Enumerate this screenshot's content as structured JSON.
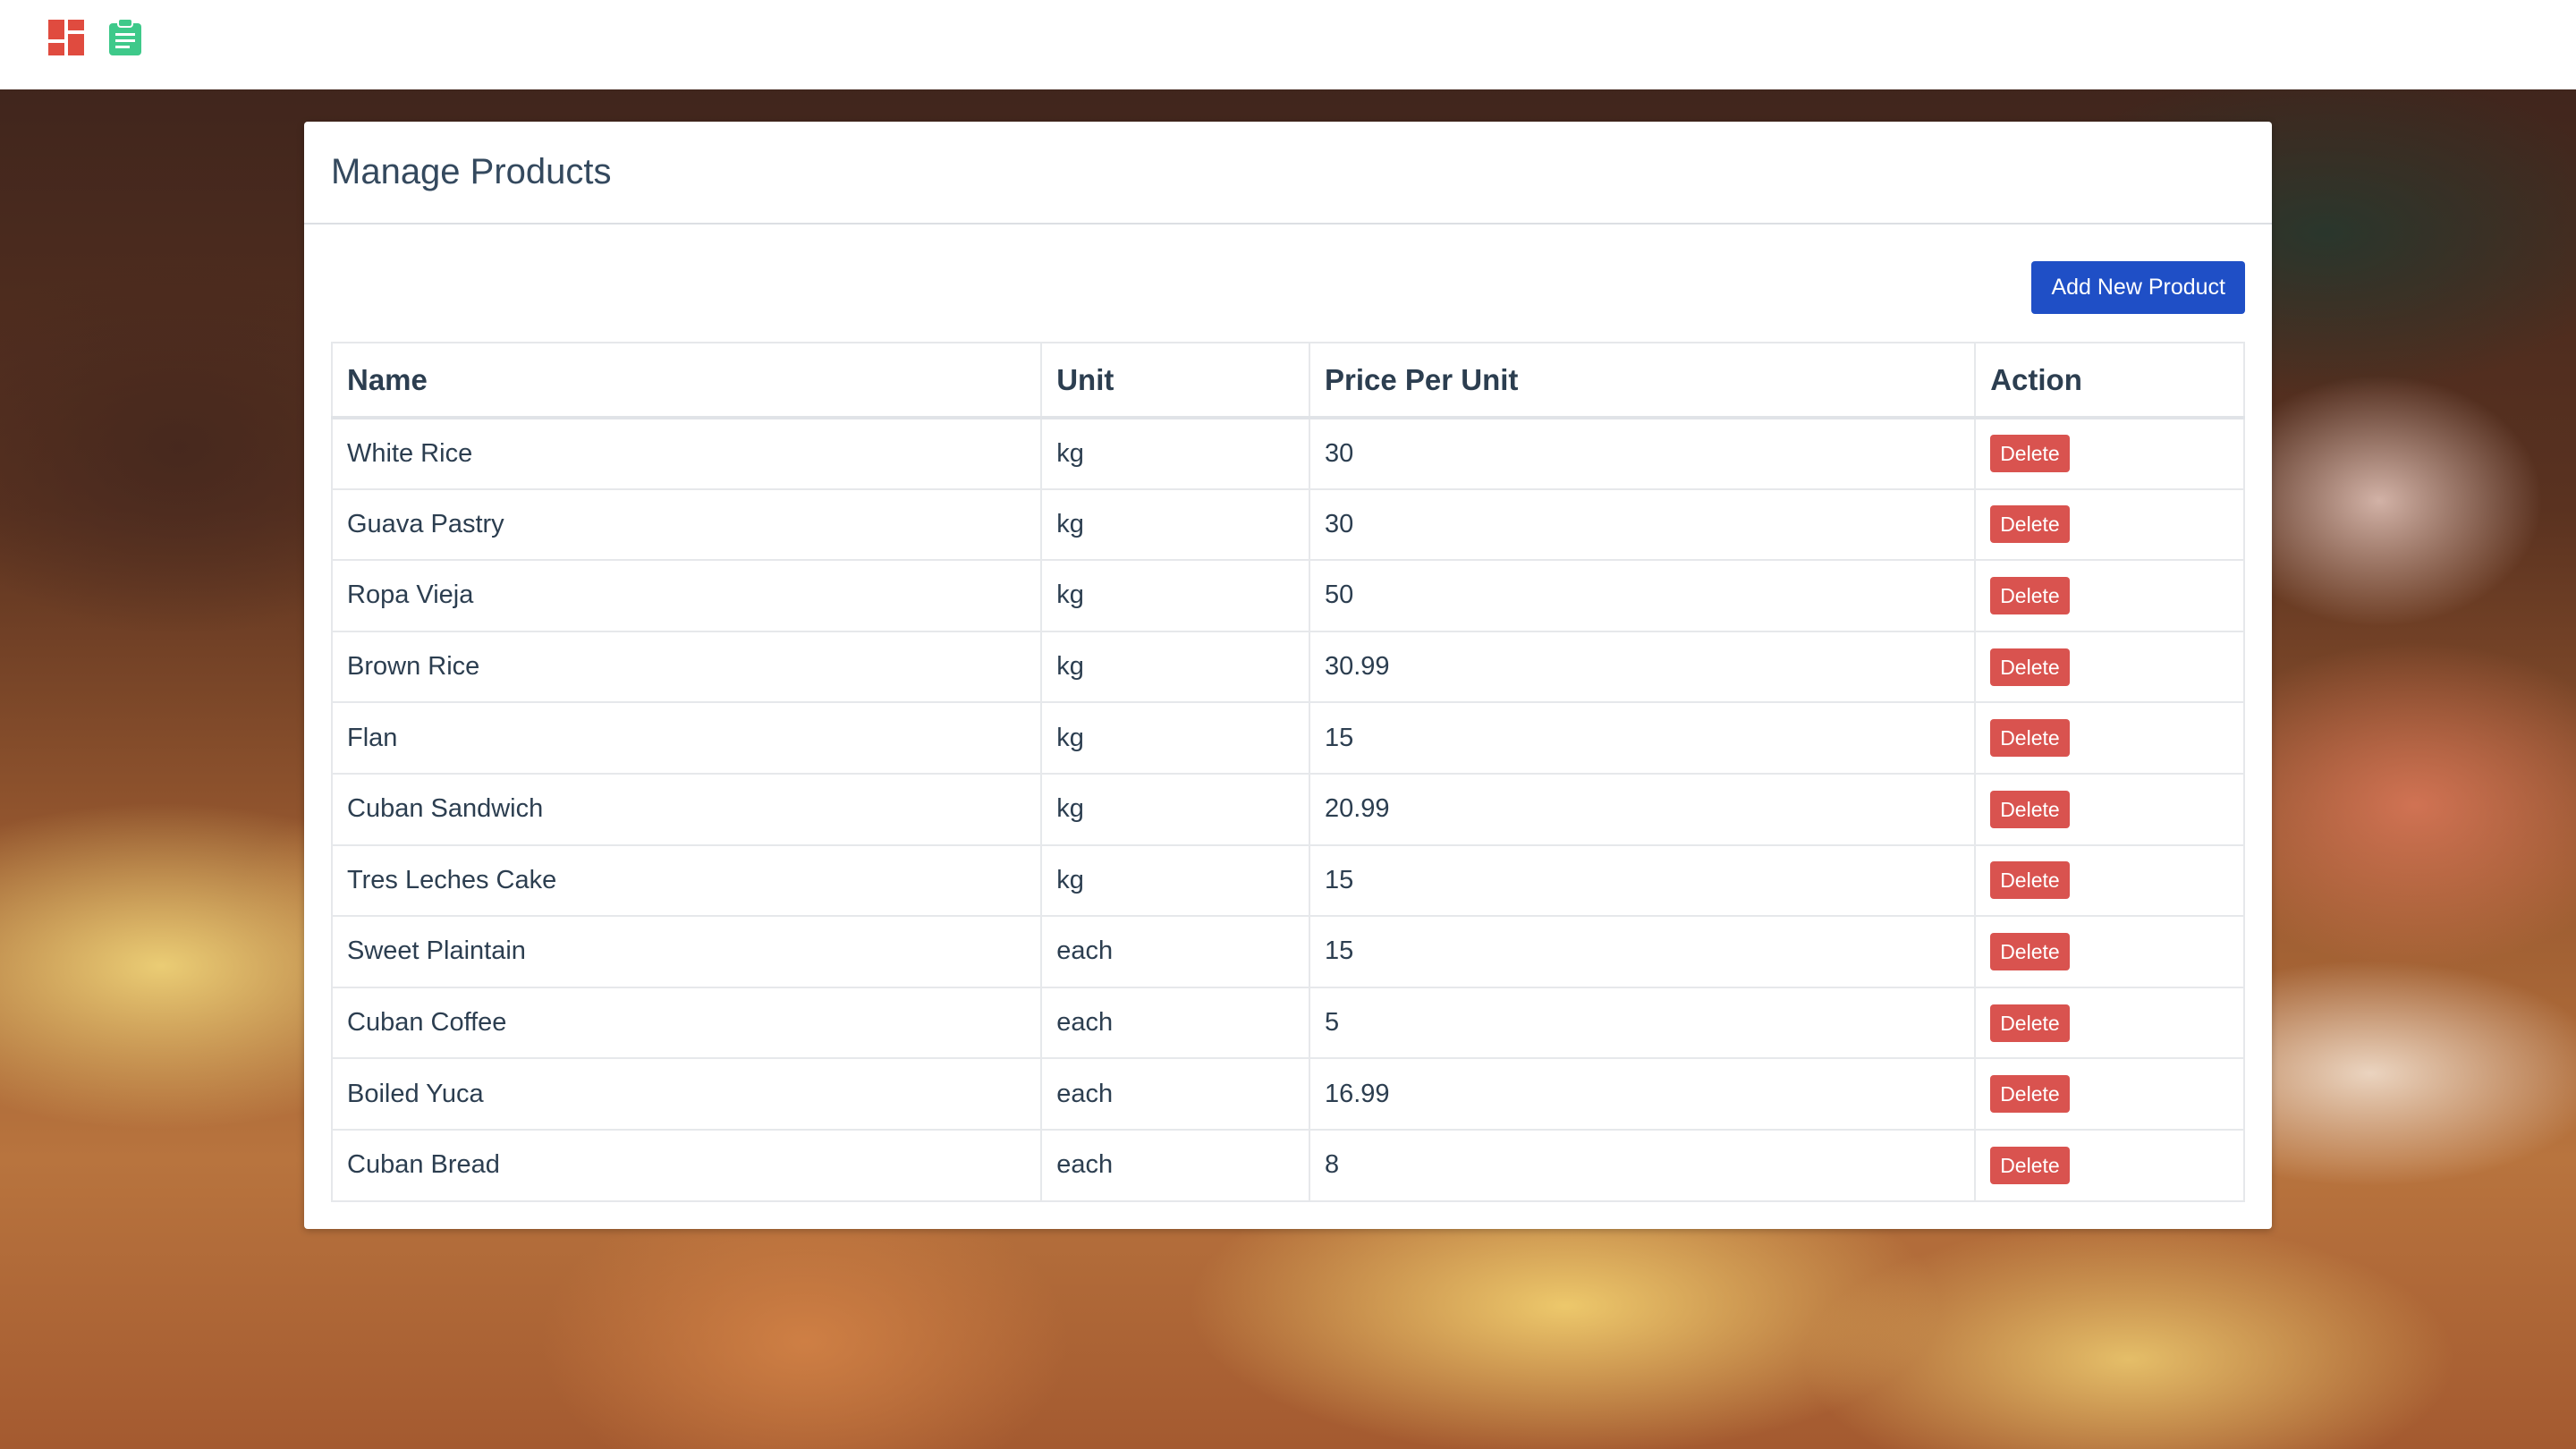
{
  "topbar": {
    "icons": [
      "dashboard-icon",
      "clipboard-icon"
    ],
    "colors": {
      "dashboard": "#e04b3f",
      "clipboard": "#3ec98a"
    }
  },
  "panel": {
    "title": "Manage Products",
    "add_button": "Add New Product"
  },
  "table": {
    "headers": [
      "Name",
      "Unit",
      "Price Per Unit",
      "Action"
    ],
    "rows": [
      {
        "name": "White Rice",
        "unit": "kg",
        "price": "30",
        "action": "Delete"
      },
      {
        "name": "Guava Pastry",
        "unit": "kg",
        "price": "30",
        "action": "Delete"
      },
      {
        "name": "Ropa Vieja",
        "unit": "kg",
        "price": "50",
        "action": "Delete"
      },
      {
        "name": "Brown Rice",
        "unit": "kg",
        "price": "30.99",
        "action": "Delete"
      },
      {
        "name": "Flan",
        "unit": "kg",
        "price": "15",
        "action": "Delete"
      },
      {
        "name": "Cuban Sandwich",
        "unit": "kg",
        "price": "20.99",
        "action": "Delete"
      },
      {
        "name": "Tres Leches Cake",
        "unit": "kg",
        "price": "15",
        "action": "Delete"
      },
      {
        "name": "Sweet Plaintain",
        "unit": "each",
        "price": "15",
        "action": "Delete"
      },
      {
        "name": "Cuban Coffee",
        "unit": "each",
        "price": "5",
        "action": "Delete"
      },
      {
        "name": "Boiled Yuca",
        "unit": "each",
        "price": "16.99",
        "action": "Delete"
      },
      {
        "name": "Cuban Bread",
        "unit": "each",
        "price": "8",
        "action": "Delete"
      }
    ]
  },
  "colors": {
    "primary_button": "#1f4fc6",
    "danger_button": "#d9534f"
  }
}
